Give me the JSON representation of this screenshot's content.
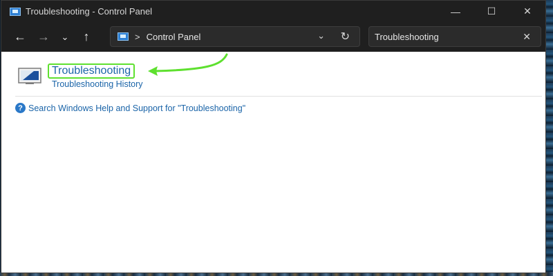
{
  "window": {
    "title": "Troubleshooting - Control Panel",
    "controls": {
      "minimize_icon": "minimize-icon",
      "maximize_icon": "maximize-icon",
      "close_icon": "close-icon"
    }
  },
  "nav": {
    "back_icon": "back-arrow-icon",
    "forward_icon": "forward-arrow-icon",
    "recent_icon": "chevron-down-icon",
    "up_icon": "up-arrow-icon"
  },
  "address": {
    "separator": ">",
    "location": "Control Panel"
  },
  "search": {
    "value": "Troubleshooting"
  },
  "results": {
    "title": "Troubleshooting",
    "subtitle": "Troubleshooting History",
    "help_link": "Search Windows Help and Support for \"Troubleshooting\""
  },
  "colors": {
    "highlight": "#5ee02f",
    "link": "#1a64a8",
    "titlebar": "#1f1f1f"
  }
}
